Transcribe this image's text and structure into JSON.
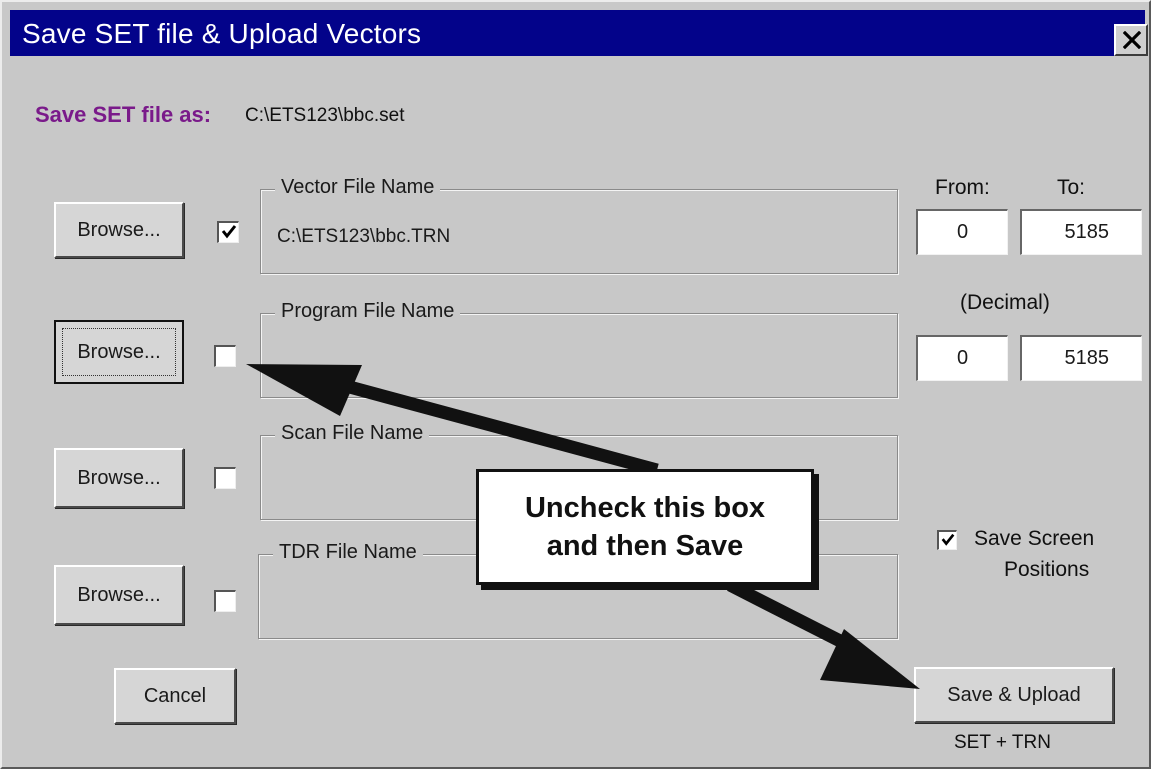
{
  "window": {
    "title": "Save SET file & Upload Vectors"
  },
  "save_set": {
    "label": "Save SET file as:",
    "path": "C:\\ETS123\\bbc.set"
  },
  "rows": [
    {
      "browse_label": "Browse...",
      "checked": true,
      "group_label": "Vector File Name",
      "value": "C:\\ETS123\\bbc.TRN"
    },
    {
      "browse_label": "Browse...",
      "checked": false,
      "group_label": "Program File Name",
      "value": ""
    },
    {
      "browse_label": "Browse...",
      "checked": false,
      "group_label": "Scan File Name",
      "value": ""
    },
    {
      "browse_label": "Browse...",
      "checked": false,
      "group_label": "TDR File Name",
      "value": ""
    }
  ],
  "range": {
    "from_label": "From:",
    "to_label": "To:",
    "decimal_label": "(Decimal)",
    "vector_from": "0",
    "vector_to": "5185",
    "program_from": "0",
    "program_to": "5185"
  },
  "save_positions": {
    "label_line1": "Save Screen",
    "label_line2": "Positions",
    "checked": true
  },
  "buttons": {
    "cancel": "Cancel",
    "save_upload": "Save & Upload",
    "save_upload_caption": "SET + TRN"
  },
  "annotation": {
    "line1": "Uncheck this box",
    "line2": "and then Save"
  },
  "colors": {
    "titlebar": "#03038a",
    "face": "#c8c8c8",
    "save_label": "#7a1a8a",
    "arrow": "#111111"
  },
  "icons": {
    "close": "close-icon",
    "check": "checkmark-icon"
  }
}
